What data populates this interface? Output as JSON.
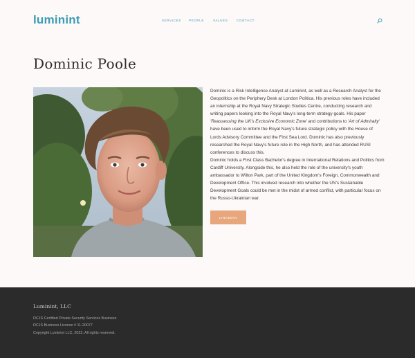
{
  "header": {
    "logo": "luminint",
    "nav": [
      {
        "label": "SERVICES"
      },
      {
        "label": "PEOPLE"
      },
      {
        "label": "VALUES"
      },
      {
        "label": "CONTACT"
      }
    ],
    "search_icon": "search-icon"
  },
  "profile": {
    "name": "Dominic Poole",
    "photo_alt": "Portrait photo of Dominic Poole",
    "bio": {
      "p1_a": "Dominic is a Risk Intelligence Analyst at Luminint, as well as a Research Analyst for the Geopolitics on the Periphery Desk at London Politica. His previous roles have included an internship at the Royal Navy Strategic Studies Centre, conducting research and writing papers looking into the Royal Navy's long-term strategy goals. His paper ",
      "p1_em1": "'Reassessing the UK's Exclusive Economic Zone'",
      "p1_b": " and contributions to ",
      "p1_em2": "'Art of Admiralty'",
      "p1_c": " have been used to inform the Royal Navy's future strategic policy with the House of Lords Advisory Committee and the First Sea Lord. Dominic has also previously researched the Royal Navy's future role in the High North, and has attended RUSI conferences to discuss this.",
      "p2": "Dominic holds a First Class Bachelor's degree in International Relations and Politics from Cardiff University. Alongside this, he also held the role of the university's youth ambassador to Wilton Park, part of the United Kingdom's Foreign, Commonwealth and Development Office. This involved research into whether the UN's Sustainable Development Goals could be met in the midst of armed conflict, with particular focus on the Russo-Ukrainian war."
    },
    "linkedin_label": "LINKEDIN"
  },
  "footer": {
    "title": "Luminint, LLC",
    "lines": [
      "DCJS Certified Private Security Services Business",
      "DCJS Business License # 11-20077",
      "Copyright Luminint LLC, 2022.  All rights reserved."
    ]
  },
  "colors": {
    "brand": "#3b9cb5",
    "button": "#e7a67c",
    "footer_bg": "#2b2b2b",
    "page_bg": "#fcf9f8"
  }
}
